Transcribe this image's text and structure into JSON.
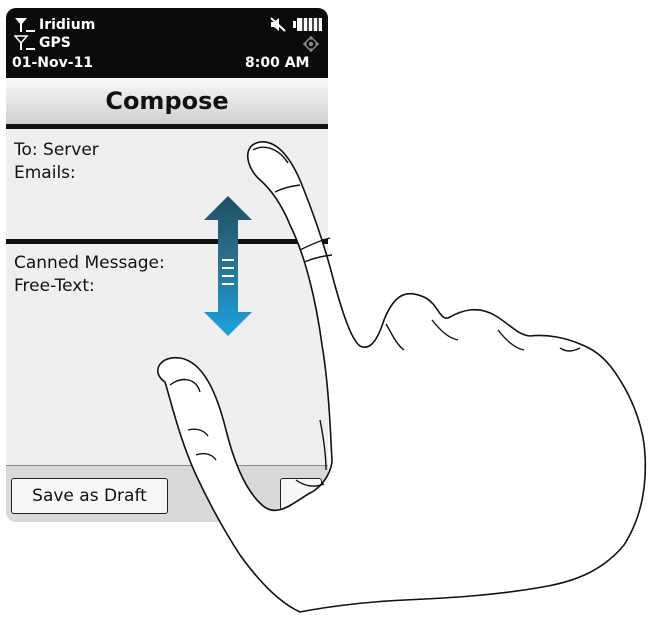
{
  "status_bar": {
    "iridium_label": "Iridium",
    "gps_label": "GPS",
    "date": "01-Nov-11",
    "time": "8:00 AM",
    "icons": [
      "satellite-signal-icon",
      "gps-signal-icon",
      "mute-icon",
      "battery-icon",
      "gps-fix-icon"
    ]
  },
  "header": {
    "title": "Compose"
  },
  "form": {
    "to_label": "To: Server",
    "emails_label": "Emails:",
    "canned_label": "Canned Message:",
    "free_text_label": "Free-Text:"
  },
  "toolbar": {
    "save_draft_label": "Save as Draft"
  },
  "overlay": {
    "gesture": "scroll-up-down-gesture",
    "icons": [
      "scroll-arrow-icon",
      "hand-pointer-icon"
    ]
  },
  "colors": {
    "status_bar_bg": "#0b0b0b",
    "arrow_top": "#1f4f66",
    "arrow_bottom": "#1aa3e0"
  }
}
